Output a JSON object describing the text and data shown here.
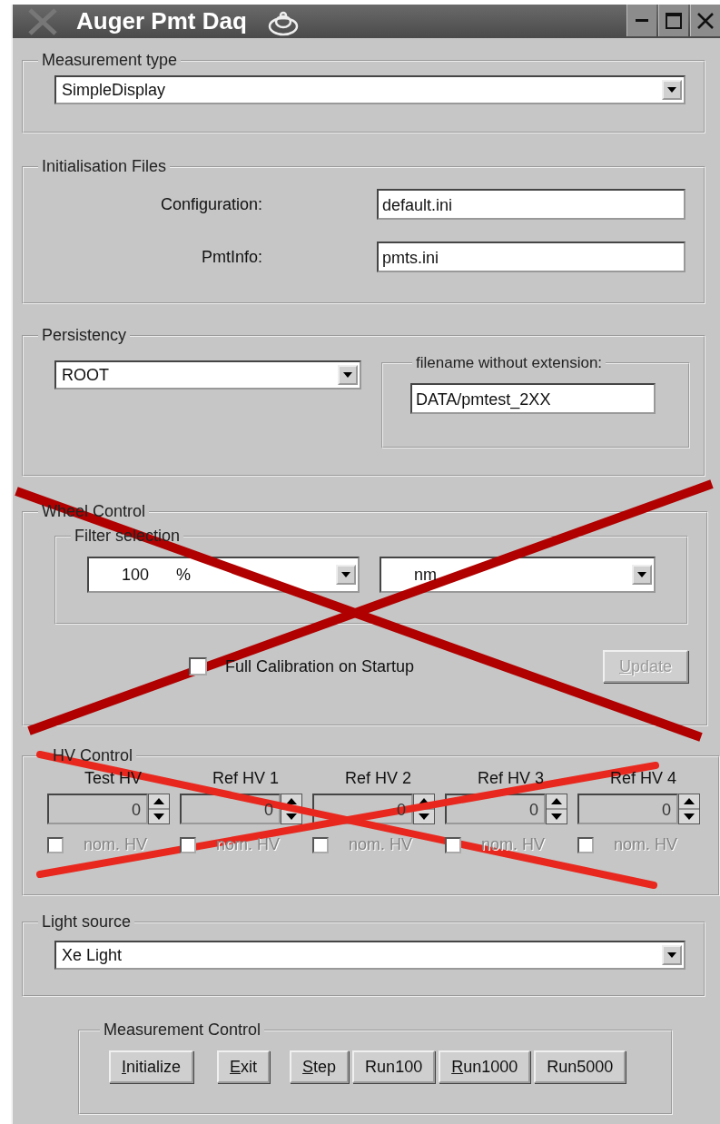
{
  "window": {
    "title": "Auger Pmt Daq"
  },
  "measurement_type": {
    "title": "Measurement type",
    "value": "SimpleDisplay"
  },
  "initialisation_files": {
    "title": "Initialisation Files",
    "fields": [
      {
        "label": "Configuration:",
        "value": "default.ini"
      },
      {
        "label": "PmtInfo:",
        "value": "pmts.ini"
      }
    ]
  },
  "persistency": {
    "title": "Persistency",
    "format": "ROOT",
    "filename": {
      "title": "filename without extension:",
      "value": "DATA/pmtest_2XX"
    }
  },
  "wheel_control": {
    "title": "Wheel Control",
    "filter_selection": {
      "title": "Filter selection",
      "intensity": "100",
      "intensity_unit": "%",
      "wavelength": "nm"
    },
    "full_calibration": {
      "label": "Full Calibration on Startup",
      "checked": false
    },
    "update_button": {
      "label": "Update",
      "disabled": true,
      "mnemonic_underlined": true
    }
  },
  "hv_control": {
    "title": "HV Control",
    "channels": [
      {
        "label": "Test HV",
        "value": "0",
        "nominal_label": "nom. HV",
        "nominal_checked": false,
        "disabled": true
      },
      {
        "label": "Ref HV 1",
        "value": "0",
        "nominal_label": "nom. HV",
        "nominal_checked": false,
        "disabled": true
      },
      {
        "label": "Ref HV 2",
        "value": "0",
        "nominal_label": "nom. HV",
        "nominal_checked": false,
        "disabled": true
      },
      {
        "label": "Ref HV 3",
        "value": "0",
        "nominal_label": "nom. HV",
        "nominal_checked": false,
        "disabled": true
      },
      {
        "label": "Ref HV 4",
        "value": "0",
        "nominal_label": "nom. HV",
        "nominal_checked": false,
        "disabled": true
      }
    ]
  },
  "light_source": {
    "title": "Light source",
    "value": "Xe Light"
  },
  "measurement_control": {
    "title": "Measurement Control",
    "buttons": [
      {
        "label": "Initialize",
        "mnemonic_underlined": true
      },
      {
        "label": "Exit",
        "mnemonic_underlined": true
      },
      {
        "label": "Step",
        "mnemonic_underlined": true
      },
      {
        "label": "Run100",
        "mnemonic_underlined": false
      },
      {
        "label": "Run1000",
        "mnemonic_underlined": true
      },
      {
        "label": "Run5000",
        "mnemonic_underlined": false
      }
    ]
  },
  "annotations": [
    {
      "kind": "cross",
      "color": "#b00000"
    },
    {
      "kind": "scribble_cross",
      "color": "#e8281e"
    }
  ]
}
